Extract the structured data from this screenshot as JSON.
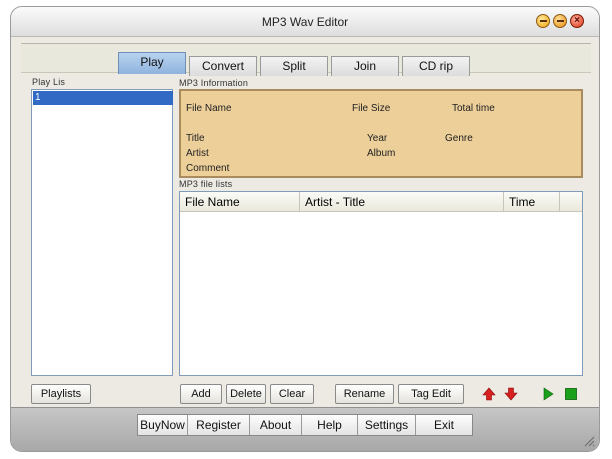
{
  "window": {
    "title": "MP3 Wav Editor"
  },
  "tabs": [
    {
      "label": "Play",
      "active": true
    },
    {
      "label": "Convert"
    },
    {
      "label": "Split"
    },
    {
      "label": "Join"
    },
    {
      "label": "CD rip"
    }
  ],
  "playlist": {
    "header": "Play Lis",
    "items": [
      "1"
    ],
    "button": "Playlists"
  },
  "mp3_info": {
    "header": "MP3 Information",
    "fields": {
      "file_name": "File Name",
      "file_size": "File Size",
      "total_time": "Total time",
      "title": "Title",
      "year": "Year",
      "genre": "Genre",
      "artist": "Artist",
      "album": "Album",
      "comment": "Comment"
    }
  },
  "file_list": {
    "header": "MP3 file lists",
    "columns": [
      "File Name",
      "Artist - Title",
      "Time"
    ]
  },
  "actions": {
    "add": "Add",
    "delete": "Delete",
    "clear": "Clear",
    "rename": "Rename",
    "tag_edit": "Tag Edit"
  },
  "icons": {
    "move_up": "arrow-up-icon",
    "move_down": "arrow-down-icon",
    "play": "play-icon",
    "stop": "stop-icon"
  },
  "bottom_menu": [
    "BuyNow",
    "Register",
    "About",
    "Help",
    "Settings",
    "Exit"
  ],
  "colors": {
    "info_background": "#edcf9a",
    "active_tab": "#8fb3dd",
    "selection": "#316ac5",
    "arrow_red": "#d82020",
    "play_green": "#1aa01a"
  }
}
